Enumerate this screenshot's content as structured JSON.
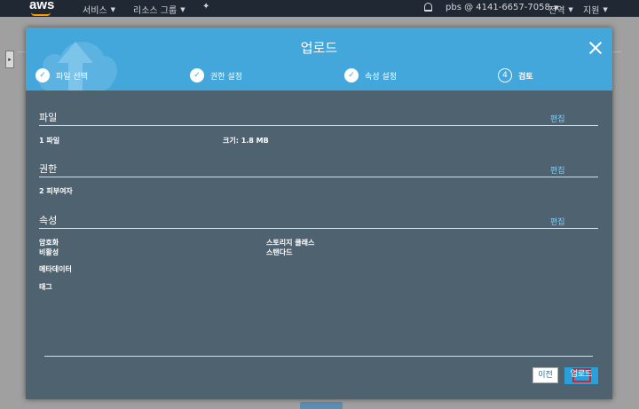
{
  "topnav": {
    "logo": "aws",
    "services": "서비스",
    "resource_groups": "리소스 그룹",
    "account": "pbs @ 4141-6657-7058",
    "region": "전역",
    "support": "지원"
  },
  "modal": {
    "title": "업로드",
    "steps": [
      {
        "label": "파일 선택",
        "state": "done"
      },
      {
        "label": "권한 설정",
        "state": "done"
      },
      {
        "label": "속성 설정",
        "state": "done"
      },
      {
        "label": "검토",
        "number": "4",
        "state": "active"
      }
    ],
    "files": {
      "title": "파일",
      "edit": "편집",
      "count": "1 파일",
      "size": "크기: 1.8 MB"
    },
    "permissions": {
      "title": "권한",
      "edit": "편집",
      "grantees": "2 피부여자"
    },
    "properties": {
      "title": "속성",
      "edit": "편집",
      "encryption_label": "암호화",
      "encryption_value": "비활성",
      "storage_class_label": "스토리지 클래스",
      "storage_class_value": "스탠다드",
      "metadata_label": "메타데이터",
      "tags_label": "태그"
    },
    "buttons": {
      "previous": "이전",
      "upload": "업로드"
    }
  },
  "colors": {
    "header": "#44a7db",
    "body": "#4f6270",
    "link": "#7fd0ff",
    "primary_button": "#2b9fd9",
    "nav": "#202833"
  }
}
